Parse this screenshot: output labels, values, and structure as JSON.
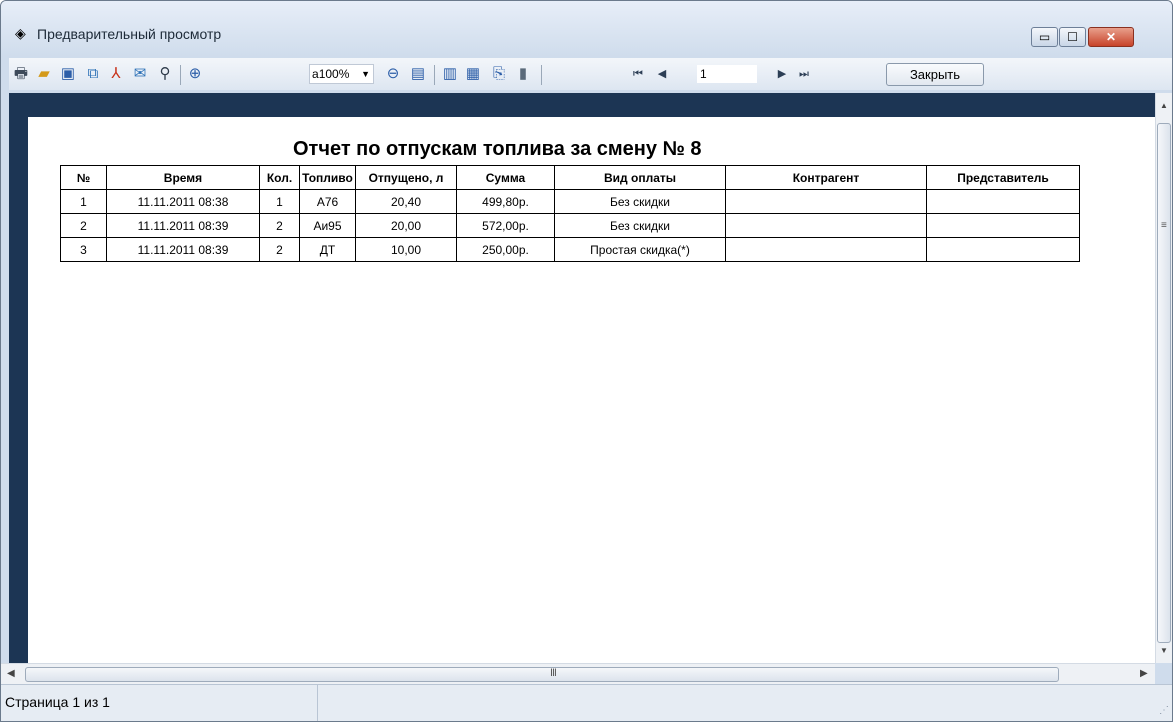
{
  "window": {
    "title": "Предварительный просмотр",
    "minimize_glyph": "▭",
    "maximize_glyph": "☐",
    "close_glyph": "✕"
  },
  "toolbar": {
    "icons": [
      "print-icon",
      "open-icon",
      "save-icon",
      "export-icon",
      "pdf-icon",
      "send-icon",
      "find-icon",
      "zoom-in-icon",
      "zoom-out-icon",
      "one-page-icon",
      "outline-icon",
      "thumbnails-icon",
      "page-setup-icon",
      "edit-icon",
      "first-page-icon",
      "prev-page-icon",
      "next-page-icon",
      "last-page-icon"
    ],
    "zoom_value": "100%",
    "zoom_prefix": "a",
    "page_value": "1",
    "close_label": "Закрыть"
  },
  "report": {
    "title": "Отчет по отпускам топлива за смену № 8",
    "columns": [
      "№",
      "Время",
      "Кол.",
      "Топливо",
      "Отпущено, л",
      "Сумма",
      "Вид оплаты",
      "Контрагент",
      "Представитель"
    ],
    "rows": [
      [
        "1",
        "11.11.2011 08:38",
        "1",
        "А76",
        "20,40",
        "499,80р.",
        "Без скидки",
        "",
        ""
      ],
      [
        "2",
        "11.11.2011 08:39",
        "2",
        "Аи95",
        "20,00",
        "572,00р.",
        "Без скидки",
        "",
        ""
      ],
      [
        "3",
        "11.11.2011 08:39",
        "2",
        "ДТ",
        "10,00",
        "250,00р.",
        "Простая скидка(*)",
        "",
        ""
      ]
    ]
  },
  "status": {
    "page_text": "Страница 1 из 1"
  }
}
